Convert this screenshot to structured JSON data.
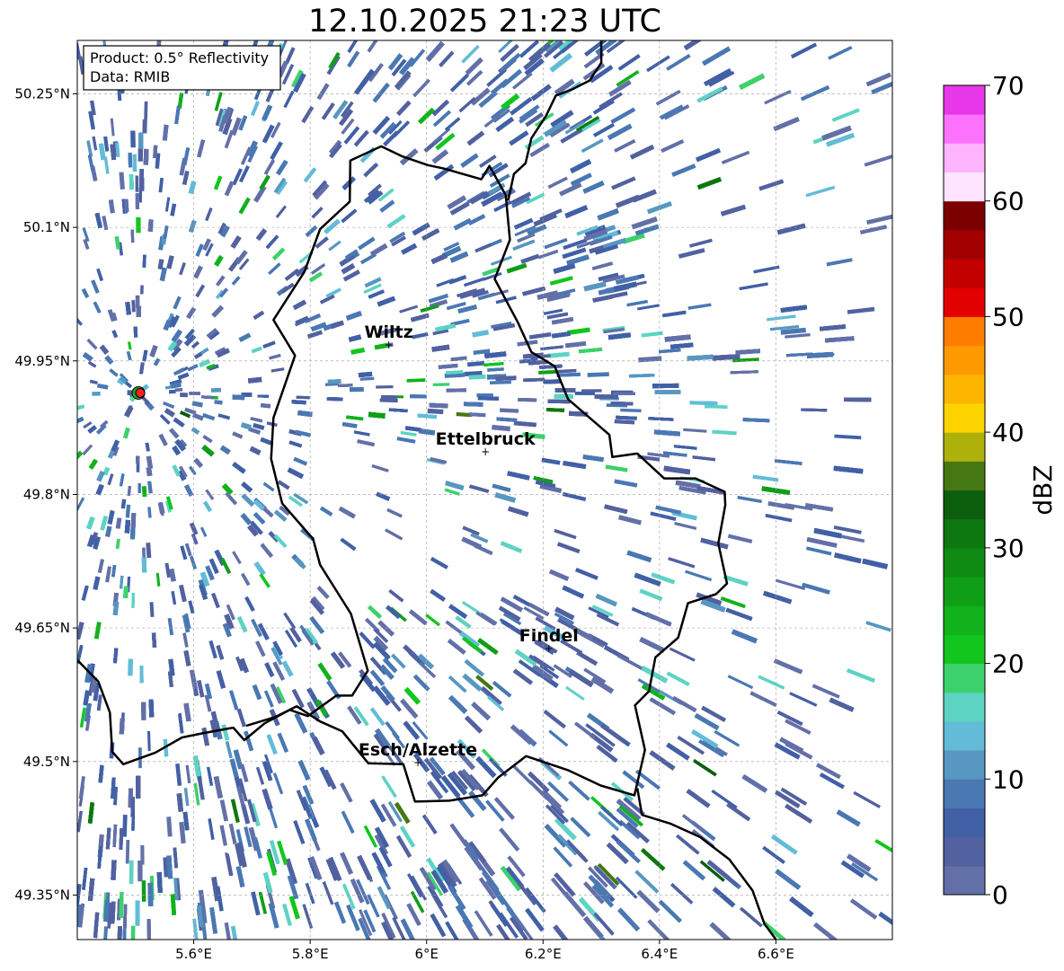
{
  "title": "12.10.2025 21:23 UTC",
  "info_box": {
    "product": "Product: 0.5° Reflectivity",
    "data": "Data: RMIB"
  },
  "map_extent": {
    "lon_min": 5.4,
    "lon_max": 6.8,
    "lat_min": 49.3,
    "lat_max": 50.31
  },
  "x_ticks": [
    {
      "lon": 5.6,
      "label": "5.6°E"
    },
    {
      "lon": 5.8,
      "label": "5.8°E"
    },
    {
      "lon": 6.0,
      "label": "6°E"
    },
    {
      "lon": 6.2,
      "label": "6.2°E"
    },
    {
      "lon": 6.4,
      "label": "6.4°E"
    },
    {
      "lon": 6.6,
      "label": "6.6°E"
    }
  ],
  "y_ticks": [
    {
      "lat": 50.25,
      "label": "50.25°N"
    },
    {
      "lat": 50.1,
      "label": "50.1°N"
    },
    {
      "lat": 49.95,
      "label": "49.95°N"
    },
    {
      "lat": 49.8,
      "label": "49.8°N"
    },
    {
      "lat": 49.65,
      "label": "49.65°N"
    },
    {
      "lat": 49.5,
      "label": "49.5°N"
    },
    {
      "lat": 49.35,
      "label": "49.35°N"
    }
  ],
  "radar_site": {
    "lon": 5.505,
    "lat": 49.914
  },
  "cities": [
    {
      "name": "Wiltz",
      "lon": 5.935,
      "lat": 49.968
    },
    {
      "name": "Ettelbruck",
      "lon": 6.101,
      "lat": 49.848
    },
    {
      "name": "Findel",
      "lon": 6.21,
      "lat": 49.627
    },
    {
      "name": "Esch/Alzette",
      "lon": 5.985,
      "lat": 49.499
    }
  ],
  "colorbar": {
    "label": "dBZ",
    "min": 0,
    "max": 70,
    "ticks": [
      "0",
      "10",
      "20",
      "30",
      "40",
      "50",
      "60",
      "70"
    ],
    "colors": [
      "#6370a8",
      "#52619f",
      "#4260a6",
      "#4a78b3",
      "#5797c1",
      "#62bcd8",
      "#5dd3c3",
      "#3dd16b",
      "#12c61d",
      "#11b21b",
      "#109e17",
      "#0f8a13",
      "#0d780f",
      "#0a5e0c",
      "#457712",
      "#aeb10b",
      "#fed400",
      "#fdb500",
      "#fe9900",
      "#fe7c00",
      "#e30000",
      "#c30000",
      "#a20000",
      "#7b0000",
      "#fee4ff",
      "#feb5fe",
      "#fe73fe",
      "#e837ea"
    ]
  },
  "borders": {
    "main": [
      [
        5.4,
        49.614
      ],
      [
        5.436,
        49.59
      ],
      [
        5.456,
        49.555
      ],
      [
        5.46,
        49.511
      ],
      [
        5.479,
        49.497
      ],
      [
        5.534,
        49.51
      ],
      [
        5.58,
        49.527
      ],
      [
        5.617,
        49.532
      ],
      [
        5.668,
        49.538
      ],
      [
        5.687,
        49.524
      ],
      [
        5.722,
        49.543
      ],
      [
        5.765,
        49.558
      ],
      [
        5.796,
        49.551
      ],
      [
        5.845,
        49.574
      ],
      [
        5.872,
        49.574
      ],
      [
        5.899,
        49.602
      ],
      [
        5.87,
        49.666
      ],
      [
        5.817,
        49.721
      ],
      [
        5.805,
        49.75
      ],
      [
        5.752,
        49.79
      ],
      [
        5.733,
        49.84
      ],
      [
        5.737,
        49.886
      ],
      [
        5.774,
        49.956
      ],
      [
        5.737,
        49.996
      ],
      [
        5.79,
        50.05
      ],
      [
        5.817,
        50.098
      ],
      [
        5.868,
        50.129
      ],
      [
        5.869,
        50.175
      ],
      [
        5.922,
        50.191
      ],
      [
        5.957,
        50.18
      ],
      [
        6.002,
        50.17
      ],
      [
        6.03,
        50.166
      ],
      [
        6.094,
        50.154
      ],
      [
        6.108,
        50.169
      ],
      [
        6.136,
        50.136
      ],
      [
        6.143,
        50.086
      ],
      [
        6.117,
        50.042
      ],
      [
        6.157,
        49.993
      ],
      [
        6.18,
        49.96
      ],
      [
        6.22,
        49.944
      ],
      [
        6.243,
        49.907
      ],
      [
        6.314,
        49.867
      ],
      [
        6.319,
        49.842
      ],
      [
        6.362,
        49.846
      ],
      [
        6.408,
        49.818
      ],
      [
        6.462,
        49.818
      ],
      [
        6.512,
        49.803
      ],
      [
        6.513,
        49.788
      ],
      [
        6.501,
        49.745
      ],
      [
        6.516,
        49.7
      ],
      [
        6.497,
        49.688
      ],
      [
        6.449,
        49.678
      ],
      [
        6.432,
        49.639
      ],
      [
        6.393,
        49.617
      ],
      [
        6.382,
        49.579
      ],
      [
        6.358,
        49.563
      ],
      [
        6.375,
        49.513
      ],
      [
        6.357,
        49.462
      ],
      [
        6.299,
        49.473
      ],
      [
        6.244,
        49.49
      ],
      [
        6.171,
        49.506
      ],
      [
        6.123,
        49.482
      ],
      [
        6.096,
        49.462
      ],
      [
        6.039,
        49.456
      ],
      [
        5.98,
        49.455
      ],
      [
        5.96,
        49.497
      ],
      [
        5.9,
        49.498
      ],
      [
        5.855,
        49.534
      ],
      [
        5.817,
        49.545
      ],
      [
        5.777,
        49.562
      ],
      [
        5.74,
        49.55
      ],
      [
        5.69,
        49.54
      ]
    ],
    "north_east": [
      [
        6.3,
        50.31
      ],
      [
        6.3,
        50.285
      ],
      [
        6.28,
        50.265
      ],
      [
        6.25,
        50.255
      ],
      [
        6.222,
        50.248
      ],
      [
        6.205,
        50.225
      ],
      [
        6.18,
        50.2
      ],
      [
        6.17,
        50.172
      ],
      [
        6.15,
        50.16
      ],
      [
        6.14,
        50.13
      ]
    ],
    "south_east": [
      [
        6.362,
        49.47
      ],
      [
        6.37,
        49.44
      ],
      [
        6.42,
        49.43
      ],
      [
        6.47,
        49.415
      ],
      [
        6.52,
        49.39
      ],
      [
        6.56,
        49.355
      ],
      [
        6.58,
        49.318
      ],
      [
        6.6,
        49.3
      ]
    ]
  }
}
